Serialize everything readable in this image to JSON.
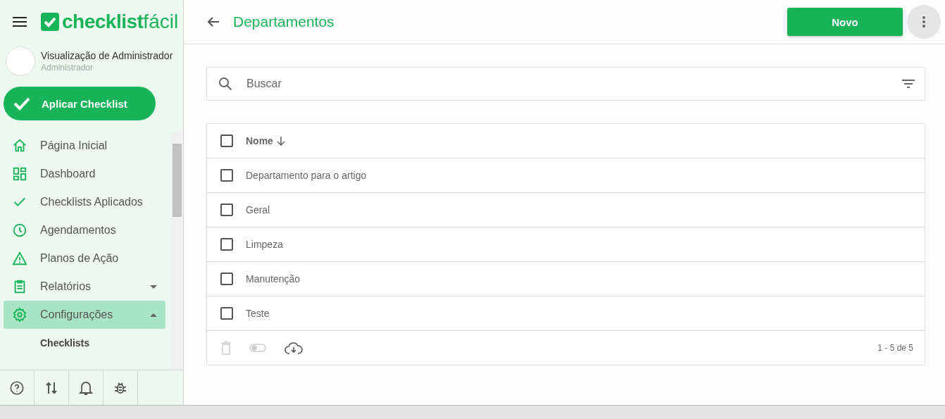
{
  "brand": {
    "name": "checklist",
    "suffix": "fácil"
  },
  "user": {
    "name": "Visualização de Administrador",
    "role": "Administrador"
  },
  "apply_button": "Aplicar Checklist",
  "nav": [
    {
      "kind": "home",
      "label": "Página Inicial",
      "selected": false
    },
    {
      "kind": "dashboard",
      "label": "Dashboard",
      "selected": false
    },
    {
      "kind": "check",
      "label": "Checklists Aplicados",
      "selected": false
    },
    {
      "kind": "clock",
      "label": "Agendamentos",
      "selected": false
    },
    {
      "kind": "warning",
      "label": "Planos de Ação",
      "selected": false
    },
    {
      "kind": "report",
      "label": "Relatórios",
      "selected": false,
      "expanded": false
    },
    {
      "kind": "gear",
      "label": "Configurações",
      "selected": true,
      "expanded": true,
      "children": [
        {
          "label": "Checklists"
        }
      ]
    }
  ],
  "page": {
    "title": "Departamentos",
    "new_button": "Novo"
  },
  "search": {
    "placeholder": "Buscar"
  },
  "table": {
    "column": "Nome",
    "select_all_checked": false,
    "rows": [
      {
        "name": "Departamento para o artigo",
        "checked": false
      },
      {
        "name": "Geral",
        "checked": false
      },
      {
        "name": "Limpeza",
        "checked": false
      },
      {
        "name": "Manutenção",
        "checked": false
      },
      {
        "name": "Teste",
        "checked": false
      }
    ],
    "actions": [
      {
        "kind": "delete",
        "disabled": true
      },
      {
        "kind": "toggle",
        "disabled": true
      },
      {
        "kind": "download",
        "disabled": false
      }
    ],
    "pagination": "1 - 5 de 5"
  }
}
